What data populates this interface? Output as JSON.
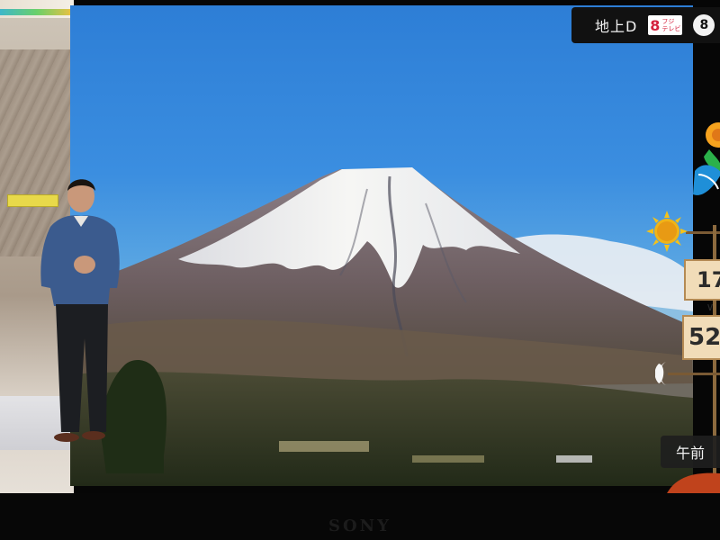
{
  "broadcast": {
    "channel_label": "地上D",
    "logo_number": "8",
    "logo_sub": "フジ\nテレビ",
    "channel_number": "8",
    "brand": "SONY"
  },
  "weather": {
    "temp_high": "17",
    "temp_low": "52",
    "time_of_day": "午前"
  },
  "scene": {
    "icons": [
      "sun-icon",
      "flower-icon",
      "moon-icon"
    ]
  },
  "colors": {
    "sky": "#3b8ee0",
    "snow": "#f3f3f0",
    "forest": "#2f3a22",
    "channel_badge": "#111111",
    "channel_logo_red": "#d4213d",
    "sign_wood": "#f1dcb8"
  }
}
